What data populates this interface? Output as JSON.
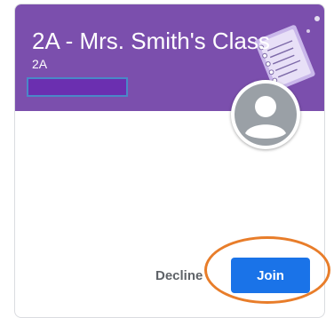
{
  "card": {
    "title": "2A - Mrs. Smith's Class",
    "section": "2A",
    "banner_color": "#7b4fad"
  },
  "actions": {
    "decline_label": "Decline",
    "join_label": "Join",
    "join_color": "#1a73e8"
  },
  "annotation": {
    "highlight_color": "#e87d2a"
  },
  "icons": {
    "illustration": "notebook-illustration",
    "avatar": "default-avatar-icon"
  }
}
